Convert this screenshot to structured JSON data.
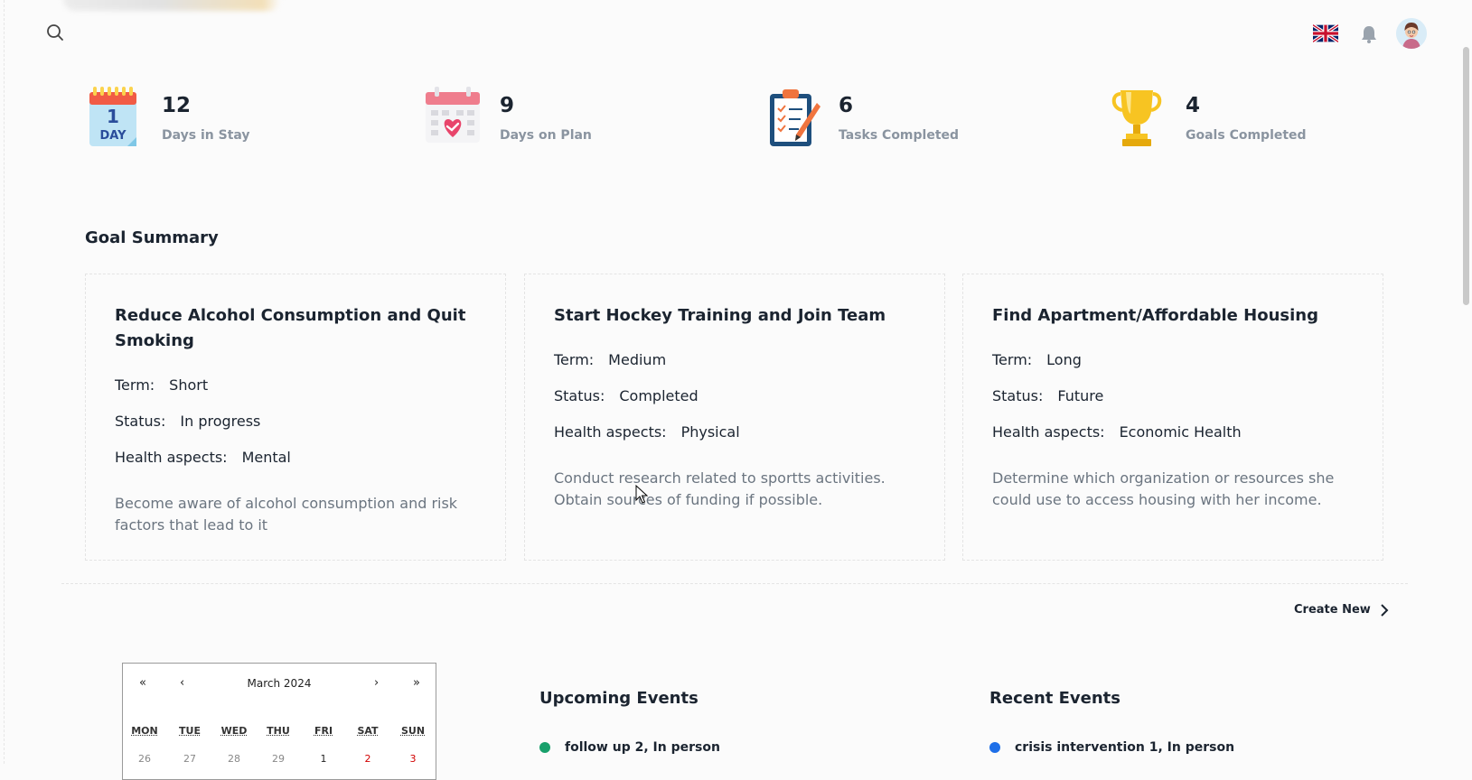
{
  "colors": {
    "accent_green": "#18a06b",
    "accent_blue": "#1e6fe8",
    "weekend_red": "#d10000"
  },
  "header": {
    "search_icon": "search-icon",
    "language_icon": "uk-flag-icon",
    "notification_icon": "bell-icon",
    "avatar_icon": "user-avatar"
  },
  "stats": [
    {
      "value": "12",
      "label": "Days in Stay",
      "icon": "calendar-1-day-icon"
    },
    {
      "value": "9",
      "label": "Days on Plan",
      "icon": "calendar-heart-icon"
    },
    {
      "value": "6",
      "label": "Tasks Completed",
      "icon": "clipboard-checklist-icon"
    },
    {
      "value": "4",
      "label": "Goals Completed",
      "icon": "trophy-icon"
    }
  ],
  "goal_summary": {
    "title": "Goal Summary",
    "term_label": "Term:",
    "status_label": "Status:",
    "health_label": "Health aspects:",
    "goals": [
      {
        "title": "Reduce Alcohol Consumption and Quit Smoking",
        "term": "Short",
        "status": "In progress",
        "health": "Mental",
        "description": "Become aware of alcohol consumption and risk factors that lead to it"
      },
      {
        "title": "Start Hockey Training and Join Team",
        "term": "Medium",
        "status": "Completed",
        "health": "Physical",
        "description": "Conduct research related to sportts activities. Obtain sources of funding if possible."
      },
      {
        "title": "Find Apartment/Affordable Housing",
        "term": "Long",
        "status": "Future",
        "health": "Economic Health",
        "description": "Determine which organization or resources she could use to access housing with her income."
      }
    ]
  },
  "create_new": {
    "label": "Create New",
    "icon": "chevron-right-icon"
  },
  "calendar": {
    "month": "March 2024",
    "nav": {
      "prev_year": "«",
      "prev_month": "‹",
      "next_month": "›",
      "next_year": "»"
    },
    "weekdays": [
      "MON",
      "TUE",
      "WED",
      "THU",
      "FRI",
      "SAT",
      "SUN"
    ],
    "first_row": [
      "26",
      "27",
      "28",
      "29",
      "1",
      "2",
      "3"
    ]
  },
  "upcoming_events": {
    "title": "Upcoming Events",
    "items": [
      "follow up 2, In person"
    ]
  },
  "recent_events": {
    "title": "Recent Events",
    "items": [
      "crisis intervention 1, In person"
    ]
  }
}
